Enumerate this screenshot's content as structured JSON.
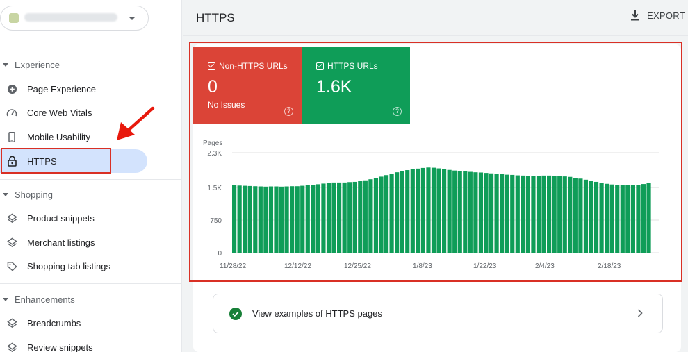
{
  "sidebar": {
    "sections": [
      {
        "label": "Experience",
        "items": [
          {
            "label": "Page Experience",
            "icon": "plus-circle-icon"
          },
          {
            "label": "Core Web Vitals",
            "icon": "gauge-icon"
          },
          {
            "label": "Mobile Usability",
            "icon": "phone-icon"
          },
          {
            "label": "HTTPS",
            "icon": "lock-icon",
            "active": true
          }
        ]
      },
      {
        "label": "Shopping",
        "items": [
          {
            "label": "Product snippets",
            "icon": "layers-icon"
          },
          {
            "label": "Merchant listings",
            "icon": "layers-icon"
          },
          {
            "label": "Shopping tab listings",
            "icon": "tag-icon"
          }
        ]
      },
      {
        "label": "Enhancements",
        "items": [
          {
            "label": "Breadcrumbs",
            "icon": "layers-icon"
          },
          {
            "label": "Review snippets",
            "icon": "layers-icon"
          }
        ]
      }
    ]
  },
  "header": {
    "title": "HTTPS",
    "export_label": "EXPORT"
  },
  "tiles": [
    {
      "label": "Non-HTTPS URLs",
      "value": "0",
      "note": "No Issues",
      "color": "#db4437"
    },
    {
      "label": "HTTPS URLs",
      "value": "1.6K",
      "note": "",
      "color": "#0f9d58"
    }
  ],
  "examples": {
    "label": "View examples of HTTPS pages"
  },
  "chart_data": {
    "type": "bar",
    "ylabel": "Pages",
    "yticks": [
      "0",
      "750",
      "1.5K",
      "2.3K"
    ],
    "ylim": [
      0,
      2300
    ],
    "xticks": [
      "11/28/22",
      "12/12/22",
      "12/25/22",
      "1/8/23",
      "1/22/23",
      "2/4/23",
      "2/18/23"
    ],
    "color": "#0f9d58",
    "values": [
      1560,
      1545,
      1540,
      1535,
      1530,
      1525,
      1520,
      1525,
      1525,
      1520,
      1525,
      1530,
      1530,
      1540,
      1550,
      1560,
      1575,
      1590,
      1605,
      1615,
      1615,
      1615,
      1625,
      1630,
      1645,
      1665,
      1690,
      1720,
      1750,
      1785,
      1820,
      1850,
      1880,
      1900,
      1920,
      1935,
      1950,
      1960,
      1955,
      1940,
      1925,
      1905,
      1890,
      1880,
      1870,
      1860,
      1850,
      1845,
      1835,
      1825,
      1815,
      1805,
      1795,
      1790,
      1780,
      1775,
      1770,
      1770,
      1770,
      1775,
      1775,
      1770,
      1765,
      1755,
      1745,
      1725,
      1705,
      1680,
      1655,
      1630,
      1605,
      1585,
      1570,
      1560,
      1555,
      1555,
      1560,
      1565,
      1580,
      1610
    ]
  }
}
